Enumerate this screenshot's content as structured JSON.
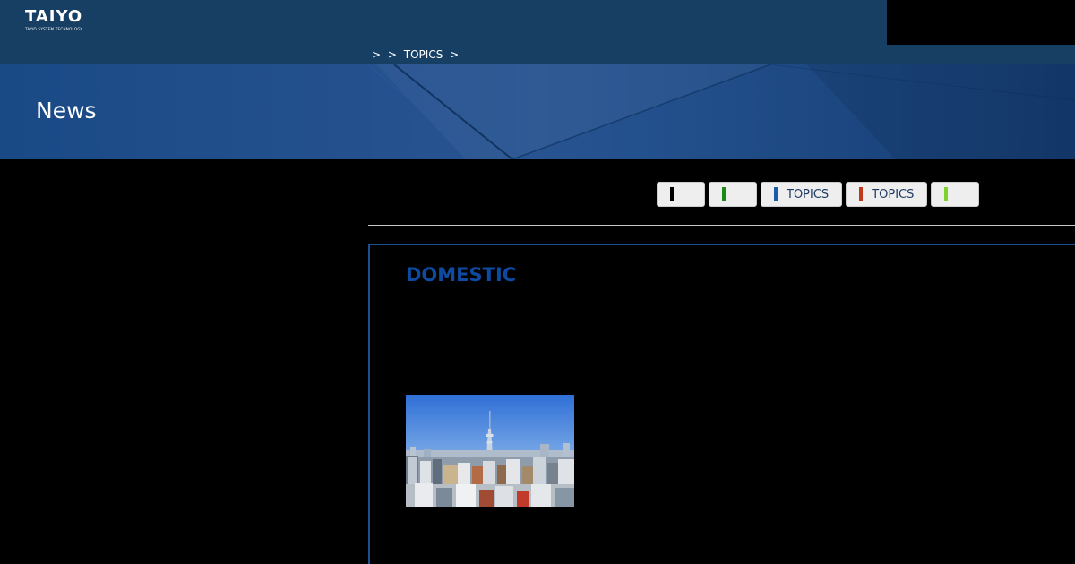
{
  "header": {
    "logo": "TAIYO",
    "logo_tagline": "TAIYO SYSTEM TECHNOLOGY"
  },
  "breadcrumb": {
    "items": [
      ">",
      ">",
      "TOPICS",
      ">"
    ]
  },
  "hero": {
    "title": "News"
  },
  "filters": {
    "tabs": [
      {
        "label": "",
        "color": "#000000"
      },
      {
        "label": "",
        "color": "#1a8a1a"
      },
      {
        "label": "TOPICS",
        "color": "#1d5aa8"
      },
      {
        "label": "TOPICS",
        "color": "#c0391b"
      },
      {
        "label": "",
        "color": "#7fd12e"
      }
    ]
  },
  "article": {
    "category": "DOMESTIC",
    "image_icon": "tokyo-skyline-photo"
  },
  "colors": {
    "header_bg": "#173f63",
    "hero_bg": "#1b4a8a",
    "accent_blue": "#0d4aa0",
    "card_border": "#1e4f95"
  }
}
